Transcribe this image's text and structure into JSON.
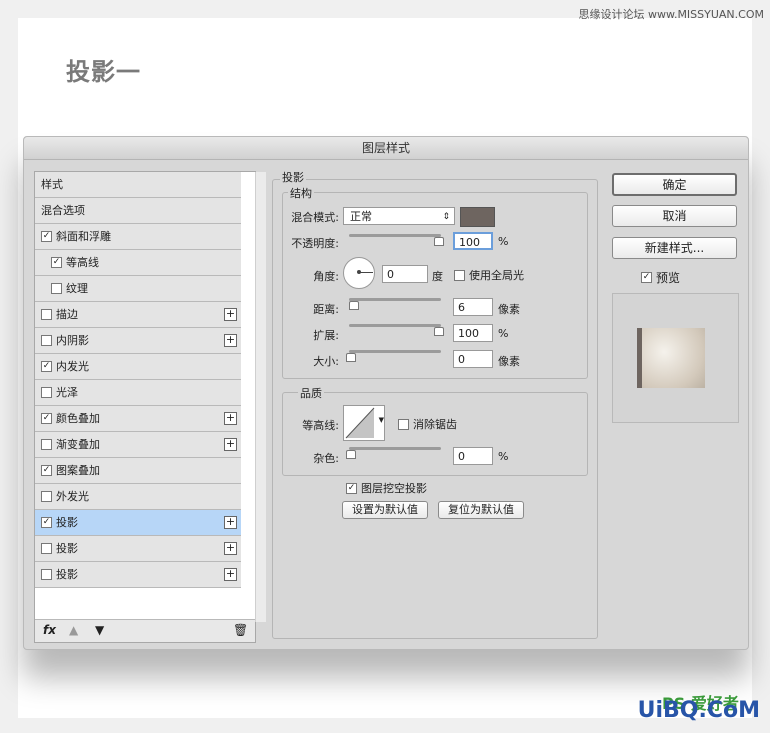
{
  "watermark_top": "思缘设计论坛 www.MISSYUAN.COM",
  "heading": "投影一",
  "dialog": {
    "title": "图层样式",
    "left_items": [
      {
        "label": "样式",
        "check": null,
        "plus": false,
        "sub": false,
        "sel": false
      },
      {
        "label": "混合选项",
        "check": null,
        "plus": false,
        "sub": false,
        "sel": false
      },
      {
        "label": "斜面和浮雕",
        "check": true,
        "plus": false,
        "sub": false,
        "sel": false
      },
      {
        "label": "等高线",
        "check": true,
        "plus": false,
        "sub": true,
        "sel": false
      },
      {
        "label": "纹理",
        "check": false,
        "plus": false,
        "sub": true,
        "sel": false
      },
      {
        "label": "描边",
        "check": false,
        "plus": true,
        "sub": false,
        "sel": false
      },
      {
        "label": "内阴影",
        "check": false,
        "plus": true,
        "sub": false,
        "sel": false
      },
      {
        "label": "内发光",
        "check": true,
        "plus": false,
        "sub": false,
        "sel": false
      },
      {
        "label": "光泽",
        "check": false,
        "plus": false,
        "sub": false,
        "sel": false
      },
      {
        "label": "颜色叠加",
        "check": true,
        "plus": true,
        "sub": false,
        "sel": false
      },
      {
        "label": "渐变叠加",
        "check": false,
        "plus": true,
        "sub": false,
        "sel": false
      },
      {
        "label": "图案叠加",
        "check": true,
        "plus": false,
        "sub": false,
        "sel": false
      },
      {
        "label": "外发光",
        "check": false,
        "plus": false,
        "sub": false,
        "sel": false
      },
      {
        "label": "投影",
        "check": true,
        "plus": true,
        "sub": false,
        "sel": true
      },
      {
        "label": "投影",
        "check": false,
        "plus": true,
        "sub": false,
        "sel": false
      },
      {
        "label": "投影",
        "check": false,
        "plus": true,
        "sub": false,
        "sel": false
      }
    ],
    "fx_label": "fx",
    "section_title": "投影",
    "structure_title": "结构",
    "blend_label": "混合模式:",
    "blend_value": "正常",
    "shadow_color": "#6e6560",
    "opacity_label": "不透明度:",
    "opacity_value": "100",
    "opacity_level": 100,
    "percent": "%",
    "angle_label": "角度:",
    "angle_value": "0",
    "degree": "度",
    "global_light_label": "使用全局光",
    "distance_label": "距离:",
    "distance_value": "6",
    "distance_level": 3,
    "pixels": "像素",
    "spread_label": "扩展:",
    "spread_value": "100",
    "spread_level": 100,
    "size_label": "大小:",
    "size_value": "0",
    "size_level": 0,
    "quality_title": "品质",
    "contour_label": "等高线:",
    "antialias_label": "消除锯齿",
    "noise_label": "杂色:",
    "noise_value": "0",
    "noise_level": 0,
    "knockout_label": "图层挖空投影",
    "set_default": "设置为默认值",
    "reset_default": "复位为默认值",
    "ok": "确定",
    "cancel": "取消",
    "new_style": "新建样式...",
    "preview_label": "预览"
  },
  "watermark_bottom": "UiBQ.CoM",
  "watermark_ps": "PS 爱好者"
}
